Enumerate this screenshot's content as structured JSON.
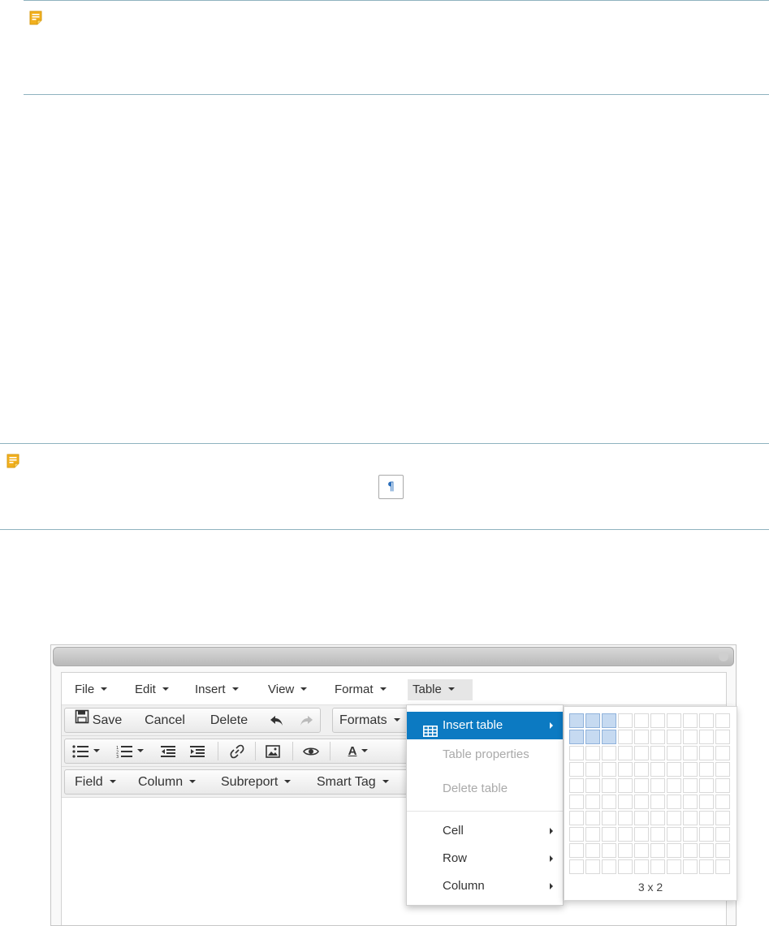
{
  "notes": [
    {
      "icon": "note-icon"
    },
    {
      "icon": "note-icon"
    }
  ],
  "pilcrow": "¶",
  "menubar": {
    "items": [
      {
        "label": "File"
      },
      {
        "label": "Edit"
      },
      {
        "label": "Insert"
      },
      {
        "label": "View"
      },
      {
        "label": "Format"
      },
      {
        "label": "Table"
      }
    ]
  },
  "toolbar1": {
    "save_label": "Save",
    "cancel_label": "Cancel",
    "delete_label": "Delete",
    "formats_label": "Formats"
  },
  "toolbar3": {
    "field_label": "Field",
    "column_label": "Column",
    "subreport_label": "Subreport",
    "smarttag_label": "Smart Tag"
  },
  "table_menu": {
    "insert_table": "Insert table",
    "table_properties": "Table properties",
    "delete_table": "Delete table",
    "cell": "Cell",
    "row": "Row",
    "column": "Column"
  },
  "grid": {
    "cols": 10,
    "rows": 10,
    "selected_cols": 3,
    "selected_rows": 2,
    "size_label": "3 x 2"
  },
  "colors": {
    "accent": "#0c7ac2",
    "note_rule": "#8fb3bf",
    "note_icon": "#f2b01e",
    "selected_cell": "#c6daf1"
  }
}
